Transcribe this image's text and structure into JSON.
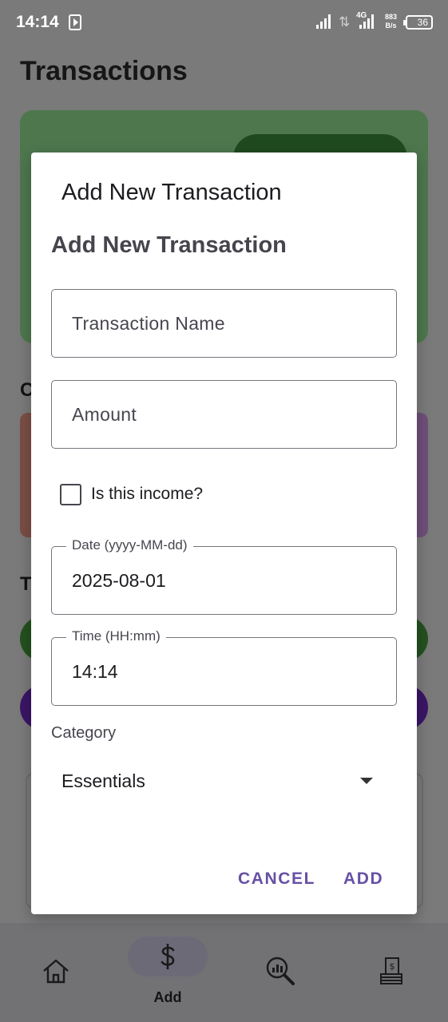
{
  "status_bar": {
    "time": "14:14",
    "network_type": "4G",
    "speed_value": "883",
    "speed_unit": "B/s",
    "battery": "36"
  },
  "background": {
    "page_title": "Transactions",
    "colors": {
      "card_green": "#4e774e",
      "pill_green": "#24511f",
      "pill_purple": "#3a1566"
    }
  },
  "dialog": {
    "title": "Add New Transaction",
    "heading": "Add New Transaction",
    "name_field": {
      "placeholder": "Transaction Name",
      "value": ""
    },
    "amount_field": {
      "placeholder": "Amount",
      "value": ""
    },
    "income_checkbox": {
      "label": "Is this income?",
      "checked": false
    },
    "date_field": {
      "label": "Date (yyyy-MM-dd)",
      "value": "2025-08-01"
    },
    "time_field": {
      "label": "Time (HH:mm)",
      "value": "14:14"
    },
    "category": {
      "label": "Category",
      "selected": "Essentials"
    },
    "buttons": {
      "cancel": "CANCEL",
      "add": "ADD"
    },
    "accent_color": "#6750a4"
  },
  "bottom_nav": {
    "items": [
      {
        "icon": "home-icon",
        "label": ""
      },
      {
        "icon": "dollar-icon",
        "label": "Add",
        "selected": true
      },
      {
        "icon": "search-analytics-icon",
        "label": ""
      },
      {
        "icon": "money-stack-icon",
        "label": ""
      }
    ]
  }
}
